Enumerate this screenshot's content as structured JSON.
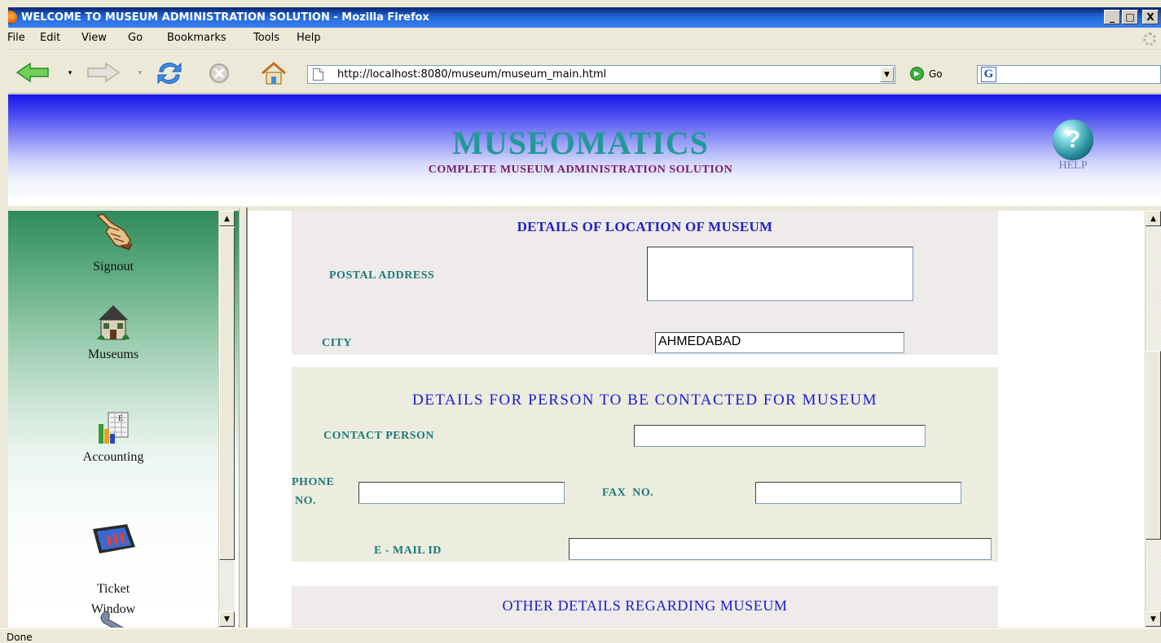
{
  "window": {
    "title": "WELCOME TO MUSEUM ADMINISTRATION SOLUTION - Mozilla Firefox",
    "controls": {
      "minimize": "_",
      "maximize": "□",
      "close": "X"
    }
  },
  "menu": {
    "items": [
      "File",
      "Edit",
      "View",
      "Go",
      "Bookmarks",
      "Tools",
      "Help"
    ]
  },
  "toolbar": {
    "url": "http://localhost:8080/museum/museum_main.html",
    "go_label": "Go",
    "search_engine_glyph": "G"
  },
  "banner": {
    "title": "MUSEOMATICS",
    "subtitle": "COMPLETE MUSEUM ADMINISTRATION SOLUTION",
    "help_label": "HELP"
  },
  "sidebar": {
    "items": [
      {
        "label": "Signout",
        "icon": "pointing-hand-icon"
      },
      {
        "label": "Museums",
        "icon": "house-icon"
      },
      {
        "label": "Accounting",
        "icon": "accounting-chart-icon"
      },
      {
        "label": "Ticket\nWindow",
        "icon": "ticket-window-icon"
      },
      {
        "label": "",
        "icon": "wrench-icon"
      }
    ]
  },
  "form": {
    "location": {
      "heading": "DETAILS OF LOCATION OF MUSEUM",
      "postal_address_label": "POSTAL ADDRESS",
      "postal_address_value": "",
      "city_label": "CITY",
      "city_value": "AHMEDABAD"
    },
    "contact": {
      "heading": "DETAILS FOR PERSON TO BE CONTACTED FOR MUSEUM",
      "contact_person_label": "CONTACT PERSON",
      "contact_person_value": "",
      "phone_label_line1": "PHONE",
      "phone_label_line2": "NO.",
      "phone_value": "",
      "fax_label": "FAX  NO.",
      "fax_value": "",
      "email_label": "E - MAIL ID",
      "email_value": ""
    },
    "other": {
      "heading": "OTHER DETAILS REGARDING MUSEUM"
    }
  },
  "status": {
    "text": "Done"
  },
  "colors": {
    "banner_top": "#1515e8",
    "brand_title": "#229999",
    "brand_subtitle": "#7a1a6a",
    "section_heading": "#2020c8",
    "field_label": "#1a7a7a",
    "sidebar_top": "#2e8a5a"
  }
}
